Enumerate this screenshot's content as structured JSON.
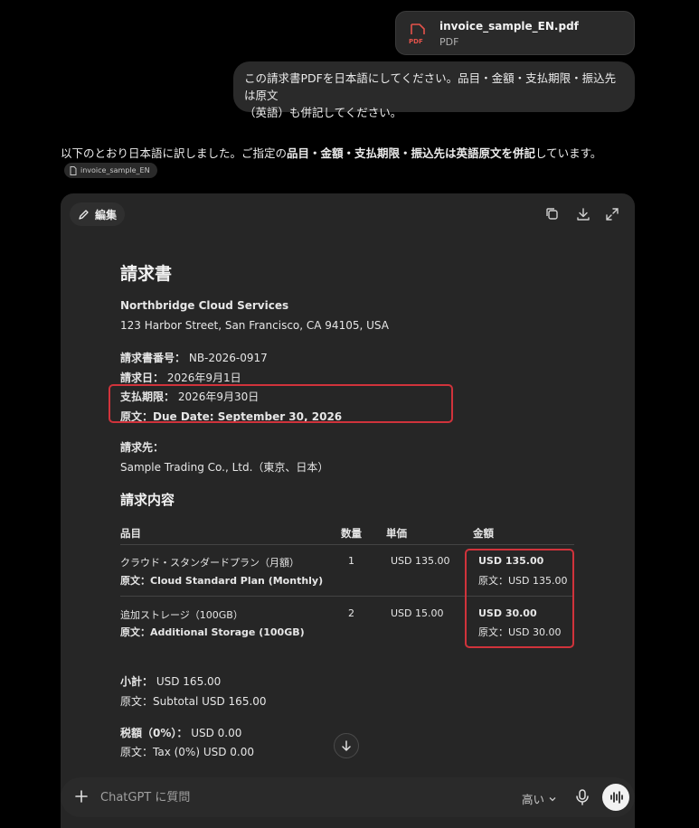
{
  "attachment": {
    "name": "invoice_sample_EN.pdf",
    "type": "PDF",
    "icon_label": "PDF"
  },
  "user_message": {
    "line1": "この請求書PDFを日本語にしてください。品目・金額・支払期限・振込先は原文",
    "line2": "（英語）も併記してください。"
  },
  "assistant": {
    "intro_pre": "以下のとおり日本語に訳しました。ご指定の",
    "intro_bold": "品目・金額・支払期限・振込先は英語原文を併記",
    "intro_post": "しています。",
    "source_chip": "invoice_sample_EN"
  },
  "canvas": {
    "edit_label": "編集",
    "icons": [
      "copy-icon",
      "download-icon",
      "expand-icon"
    ]
  },
  "invoice": {
    "title": "請求書",
    "company": "Northbridge Cloud Services",
    "address": "123 Harbor Street, San Francisco, CA 94105, USA",
    "invoice_no_label": "請求書番号：",
    "invoice_no": "NB-2026-0917",
    "invoice_date_label": "請求日：",
    "invoice_date": "2026年9月1日",
    "due_label": "支払期限：",
    "due_date": "2026年9月30日",
    "due_original": "原文：Due Date: September 30, 2026",
    "bill_to_label": "請求先：",
    "bill_to": "Sample Trading Co., Ltd.（東京、日本）",
    "items_heading": "請求内容",
    "table": {
      "headers": [
        "品目",
        "数量",
        "単価",
        "金額"
      ],
      "rows": [
        {
          "item": "クラウド・スタンダードプラン（月額）",
          "item_original": "原文：Cloud Standard Plan (Monthly)",
          "qty": "1",
          "unit_price": "USD 135.00",
          "amount": "USD 135.00",
          "amount_original": "原文：USD 135.00"
        },
        {
          "item": "追加ストレージ（100GB）",
          "item_original": "原文：Additional Storage (100GB)",
          "qty": "2",
          "unit_price": "USD 15.00",
          "amount": "USD 30.00",
          "amount_original": "原文：USD 30.00"
        }
      ]
    },
    "subtotal_label": "小計：",
    "subtotal": "USD 165.00",
    "subtotal_original": "原文：Subtotal USD 165.00",
    "tax_label": "税額（0%）：",
    "tax": "USD 0.00",
    "tax_original": "原文：Tax (0%) USD 0.00"
  },
  "composer": {
    "placeholder": "ChatGPT に質問",
    "model": "高い"
  },
  "colors": {
    "highlight": "#d0333b",
    "pdf_icon": "#e5534b"
  }
}
